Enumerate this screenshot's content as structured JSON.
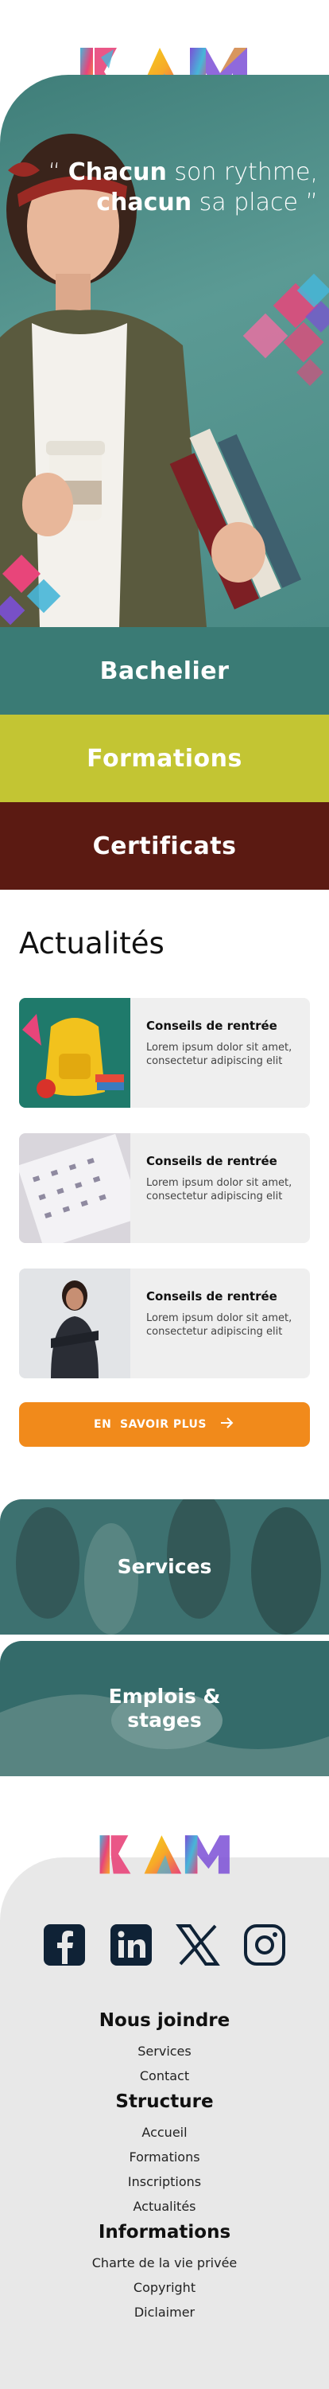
{
  "brand": {
    "logo_text": "KAM",
    "logo_colors": [
      "#e8457a",
      "#f7a928",
      "#f2d61a",
      "#47b6d8",
      "#7b4fd6"
    ]
  },
  "hero": {
    "quote_line1_bold": "Chacun",
    "quote_line1_rest": " son rythme,",
    "quote_line2_bold": "chacun",
    "quote_line2_rest": " sa place ”",
    "quote_open": "“ "
  },
  "nav_blocks": [
    {
      "label": "Bachelier",
      "color": "#3a7b75"
    },
    {
      "label": "Formations",
      "color": "#c3c533"
    },
    {
      "label": "Certificats",
      "color": "#5b1a12"
    }
  ],
  "news": {
    "title": "Actualités",
    "items": [
      {
        "title": "Conseils de rentrée",
        "body": "Lorem ipsum dolor sit amet, consectetur adipiscing elit"
      },
      {
        "title": "Conseils de rentrée",
        "body": "Lorem ipsum dolor sit amet, consectetur adipiscing elit"
      },
      {
        "title": "Conseils de rentrée",
        "body": "Lorem ipsum dolor sit amet, consectetur adipiscing elit"
      }
    ],
    "more_label": "EN  SAVOIR PLUS",
    "more_icon": "arrow-right-icon"
  },
  "feature_blocks": [
    {
      "label": "Services"
    },
    {
      "label": "Emplois &",
      "label2": "stages"
    }
  ],
  "footer": {
    "socials": [
      "facebook-icon",
      "linkedin-icon",
      "x-icon",
      "instagram-icon"
    ],
    "col1": {
      "heading": "Nous joindre",
      "links": [
        "Services",
        "Contact"
      ]
    },
    "col2": {
      "heading": "Structure",
      "links": [
        "Accueil",
        "Formations",
        "Inscriptions",
        "Actualités"
      ]
    },
    "col3": {
      "heading": "Informations",
      "links": [
        "Charte de la vie privée",
        "Copyright",
        "Diclaimer"
      ]
    }
  }
}
